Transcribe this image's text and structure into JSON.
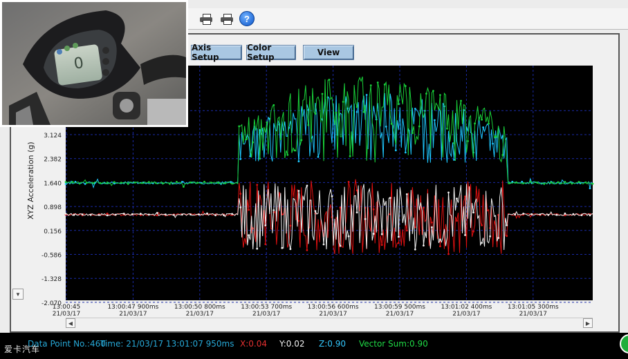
{
  "tabs": [
    {
      "label": "Axis Setup"
    },
    {
      "label": "Color Setup"
    },
    {
      "label": "View"
    }
  ],
  "toolbar": {
    "icons": [
      "printer-icon",
      "printer-icon",
      "help-icon"
    ],
    "help_glyph": "?"
  },
  "colors": {
    "plot_bg": "#000000",
    "grid": "#1a2aa8",
    "vector_sum": "#19d23a",
    "x_axis": "#e01010",
    "y_axis": "#f2f2f2",
    "z_axis": "#1ec8ff"
  },
  "chart_data": {
    "type": "line",
    "ylabel": "XYZ  Acceleration (g)",
    "ylim": [
      -2.07,
      3.866
    ],
    "yticks": [
      "3.124",
      "2.382",
      "1.640",
      "0.898",
      "0.156",
      "-0.586",
      "-1.328",
      "-2.070"
    ],
    "xticks": [
      {
        "time": "13:00:45",
        "date": "21/03/17"
      },
      {
        "time": "13:00:47 900ms",
        "date": "21/03/17"
      },
      {
        "time": "13:00:50 800ms",
        "date": "21/03/17"
      },
      {
        "time": "13:00:53 700ms",
        "date": "21/03/17"
      },
      {
        "time": "13:00:56 600ms",
        "date": "21/03/17"
      },
      {
        "time": "13:00:59 500ms",
        "date": "21/03/17"
      },
      {
        "time": "13:01:02 400ms",
        "date": "21/03/17"
      },
      {
        "time": "13:01:05 300ms",
        "date": "21/03/17"
      }
    ],
    "grid": true,
    "active_window_s": [
      7.5,
      19.2
    ],
    "series": [
      {
        "key": "vector_sum",
        "baseline": 0.9,
        "active_min": 1.4,
        "active_peak": 3.7
      },
      {
        "key": "z_axis",
        "baseline": 0.9,
        "active_min": 1.4,
        "active_peak": 3.2
      },
      {
        "key": "x_axis",
        "baseline": 0.1,
        "active_min": -0.9,
        "active_peak": 1.0
      },
      {
        "key": "y_axis",
        "baseline": 0.1,
        "active_min": -0.8,
        "active_peak": 0.9
      }
    ]
  },
  "status": {
    "data_point": "Data Point No.:460",
    "time": "Time: 21/03/17 13:01:07 950ms",
    "x": "X:0.04",
    "y": "Y:0.02",
    "z": "Z:0.90",
    "vector_sum": "Vector Sum:0.90"
  },
  "watermark": "爱卡汽车",
  "dash": {
    "digit": "0"
  }
}
